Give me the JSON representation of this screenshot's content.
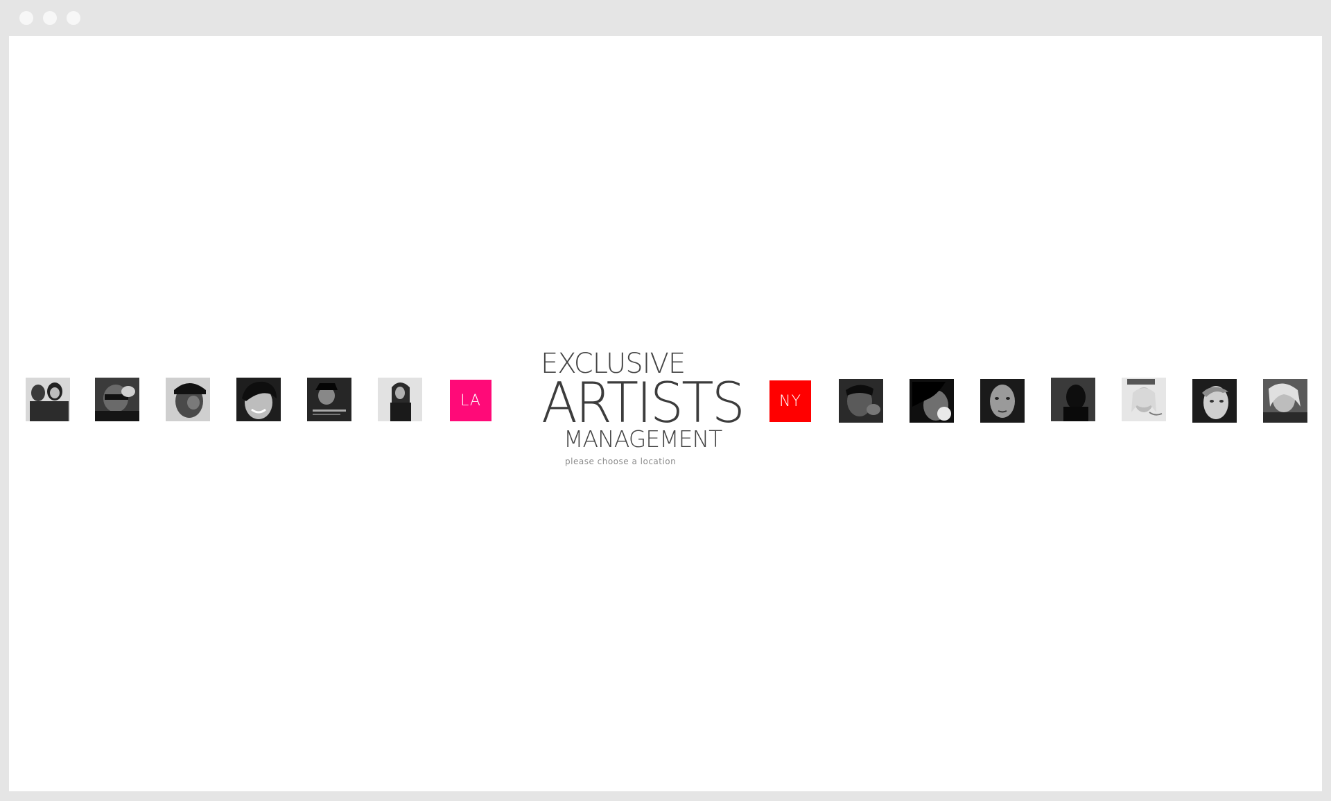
{
  "colors": {
    "la_button": "#ff0a78",
    "ny_button": "#ff0000",
    "logo_text": "#3c3c3c",
    "subtext": "#8a8a8a"
  },
  "logo": {
    "line1": "EXCLUSIVE",
    "line2": "ARTISTS",
    "line3": "MANAGEMENT",
    "subtitle": "please choose a location"
  },
  "locations": {
    "la": "LA",
    "ny": "NY"
  },
  "left_thumbnails": [
    "artist-photo-1",
    "artist-photo-2",
    "artist-photo-3",
    "artist-photo-4",
    "artist-photo-5",
    "artist-photo-6"
  ],
  "right_thumbnails": [
    "artist-photo-7",
    "artist-photo-8",
    "artist-photo-9",
    "artist-photo-10",
    "artist-photo-11",
    "artist-photo-12",
    "artist-photo-13"
  ]
}
